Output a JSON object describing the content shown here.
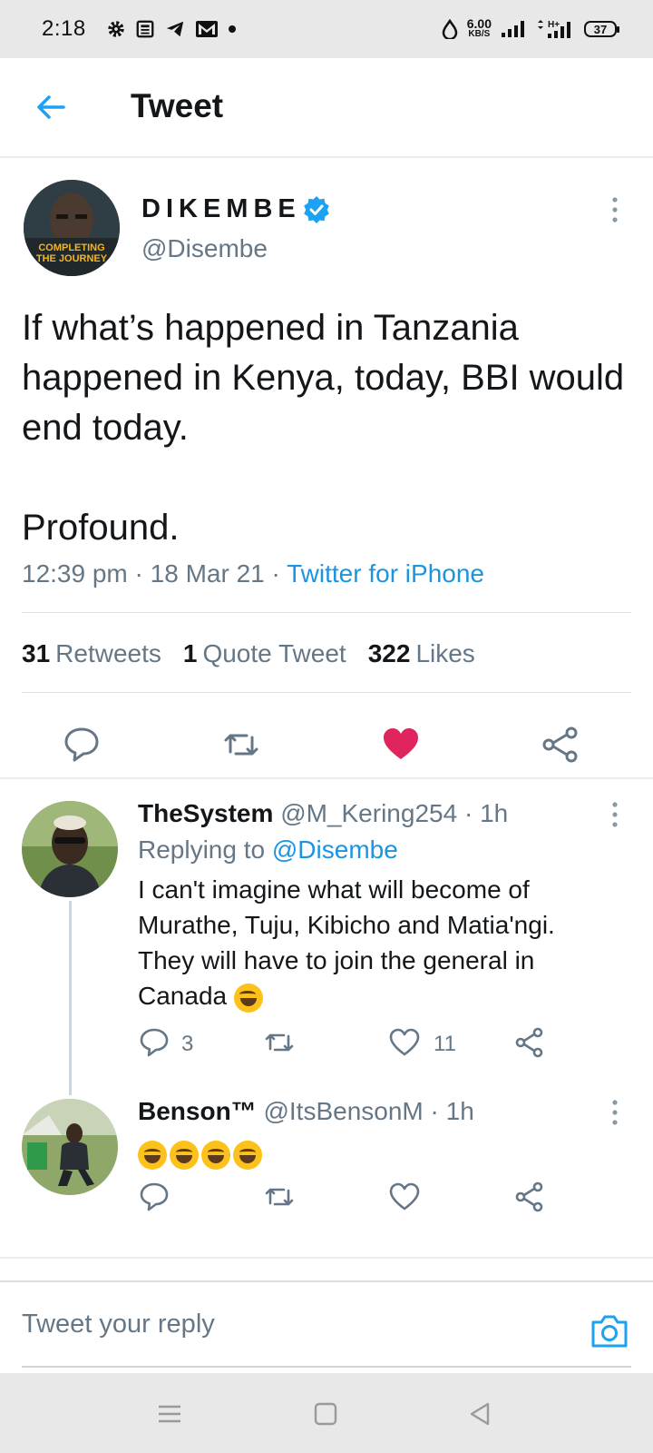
{
  "status_bar": {
    "time": "2:18",
    "net_speed": "6.00",
    "net_unit": "KB/S",
    "network_type": "H+",
    "battery": "37",
    "icons": [
      "gear-icon",
      "news-icon",
      "telegram-icon",
      "gmail-icon",
      "dot-icon",
      "drop-icon",
      "signal-icon",
      "signal-icon",
      "battery-icon"
    ]
  },
  "header": {
    "back_icon": "arrow-left-icon",
    "title": "Tweet"
  },
  "tweet": {
    "author_name": "DIKEMBE",
    "handle": "@Disembe",
    "avatar_text_line1": "COMPLETING",
    "avatar_text_line2": "THE JOURNEY",
    "text": "If what’s happened in Tanzania happened in Kenya, today, BBI would end today.\n\nProfound.",
    "time": "12:39 pm",
    "date": "18 Mar 21",
    "source": "Twitter for iPhone",
    "retweets_count": "31",
    "retweets_label": "Retweets",
    "quote_count": "1",
    "quote_label": "Quote Tweet",
    "likes_count": "322",
    "likes_label": "Likes",
    "liked": true,
    "colors": {
      "like": "#e0245e",
      "link": "#1b95e0",
      "muted": "#657786"
    }
  },
  "replies": [
    {
      "name": "TheSystem",
      "handle": "@M_Kering254",
      "time": "1h",
      "replying_prefix": "Replying to",
      "replying_to": "@Disembe",
      "text": "I can't imagine what will become of Murathe, Tuju, Kibicho and Matia'ngi. They will have to join the general in Canada",
      "reply_count": "3",
      "like_count": "11"
    },
    {
      "name": "Benson™",
      "handle": "@ItsBensonM",
      "time": "1h",
      "emoji_count": 4
    }
  ],
  "compose": {
    "placeholder": "Tweet your reply",
    "camera_icon": "camera-icon"
  },
  "navbar": {
    "icons": [
      "menu-icon",
      "home-square-icon",
      "back-triangle-icon"
    ]
  }
}
